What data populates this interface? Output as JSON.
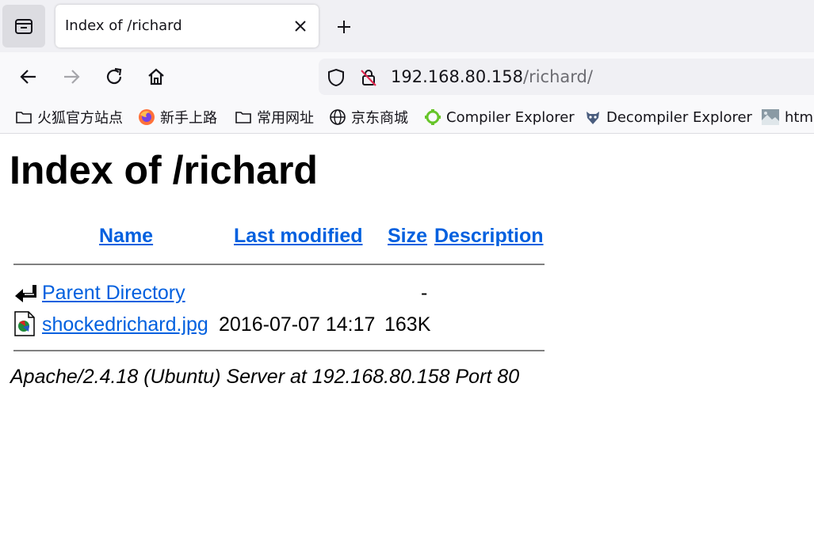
{
  "browser": {
    "tab": {
      "title": "Index of /richard",
      "close_icon": "close-icon"
    },
    "new_tab_icon": "plus-icon",
    "tab_list_icon": "tab-list-icon",
    "nav": {
      "back_icon": "arrow-left-icon",
      "forward_icon": "arrow-right-icon",
      "reload_icon": "reload-icon",
      "home_icon": "home-icon"
    },
    "url": {
      "host": "192.168.80.158",
      "path": "/richard/",
      "shield_icon": "shield-icon",
      "insecure_icon": "insecure-lock-icon"
    },
    "bookmarks": [
      {
        "label": "火狐官方站点",
        "icon": "folder-icon"
      },
      {
        "label": "新手上路",
        "icon": "firefox-icon"
      },
      {
        "label": "常用网址",
        "icon": "folder-icon"
      },
      {
        "label": "京东商城",
        "icon": "globe-icon"
      },
      {
        "label": "Compiler Explorer",
        "icon": "compiler-explorer-icon"
      },
      {
        "label": "Decompiler Explorer",
        "icon": "decompiler-explorer-icon"
      },
      {
        "label": "html",
        "icon": "thumbnail-icon"
      }
    ]
  },
  "page": {
    "heading": "Index of /richard",
    "columns": {
      "name": "Name",
      "last_modified": "Last modified",
      "size": "Size",
      "description": "Description"
    },
    "rows": [
      {
        "name": "Parent Directory",
        "last_modified": "",
        "size": "-",
        "description": "",
        "icon": "back-arrow-icon"
      },
      {
        "name": "shockedrichard.jpg",
        "last_modified": "2016-07-07 14:17",
        "size": "163K",
        "description": "",
        "icon": "image-file-icon"
      }
    ],
    "footer": "Apache/2.4.18 (Ubuntu) Server at 192.168.80.158 Port 80"
  },
  "colors": {
    "link": "#0060df",
    "tabstrip": "#f0f0f4",
    "toolbar": "#f9f9fb"
  }
}
